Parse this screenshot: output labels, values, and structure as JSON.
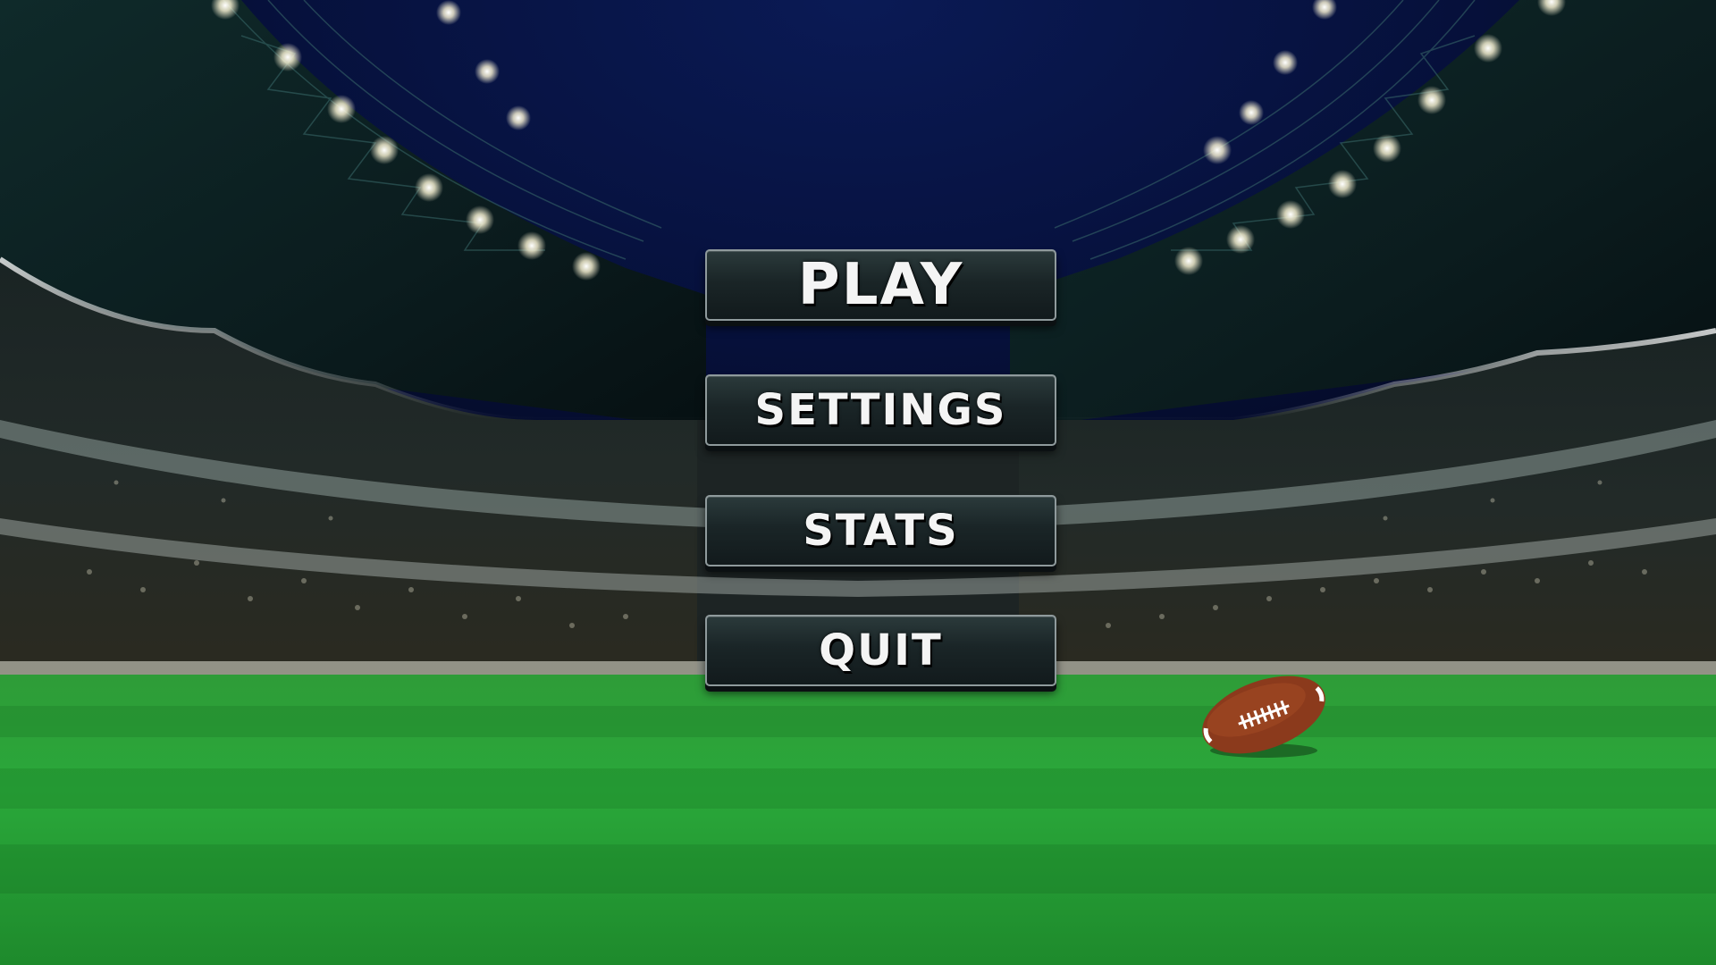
{
  "menu": {
    "play_label": "PLAY",
    "settings_label": "SETTINGS",
    "stats_label": "STATS",
    "quit_label": "QUIT"
  },
  "scene": {
    "background": "stadium-at-night",
    "icons": [
      "football-icon",
      "stadium-lights-icon"
    ],
    "colors": {
      "sky": "#050d2e",
      "field_light": "#35b843",
      "field_dark": "#1f8a2e",
      "button_bg": "#1a2527",
      "button_border": "#8f9a9c",
      "button_text": "#ffffff",
      "football_brown": "#8b3a1c"
    }
  }
}
